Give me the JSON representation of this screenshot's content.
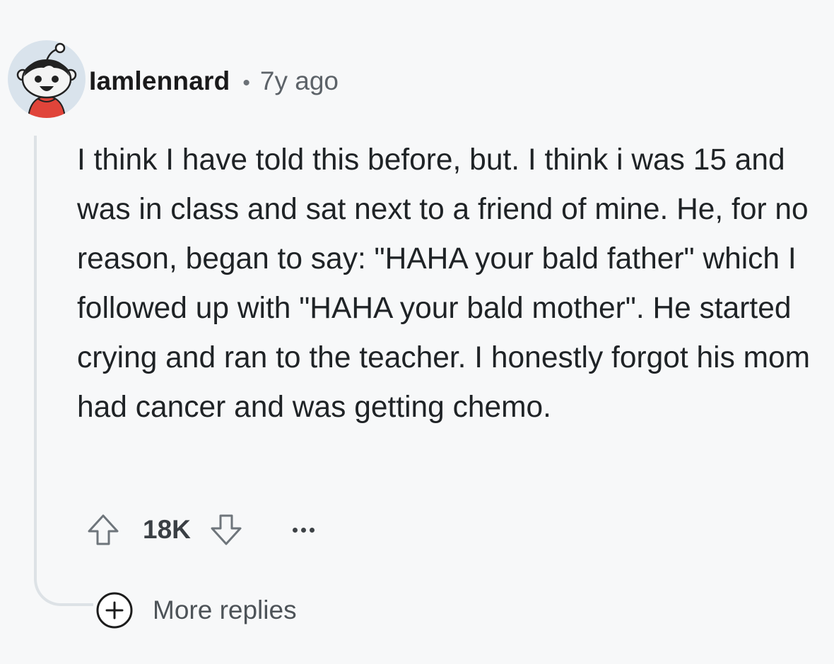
{
  "comment": {
    "username": "Iamlennard",
    "separator": "•",
    "timestamp": "7y ago",
    "body": "I think I have told this before, but. I think i was 15 and was in class and sat next to a friend of mine. He, for no reason, began to say: \"HAHA your bald father\" which I followed up with \"HAHA your bald mother\". He started crying and ran to the teacher. I honestly forgot his mom had cancer and was getting chemo.",
    "score": "18K",
    "more_replies_label": "More replies"
  },
  "icons": {
    "avatar": "snoo-avatar",
    "upvote": "arrow-up-icon",
    "downvote": "arrow-down-icon",
    "overflow": "ellipsis-icon",
    "expand": "plus-circle-icon"
  },
  "colors": {
    "background": "#f7f8f9",
    "thread_line": "#dde2e6",
    "avatar_bg": "#d9e3ec",
    "shirt": "#e0443a"
  }
}
